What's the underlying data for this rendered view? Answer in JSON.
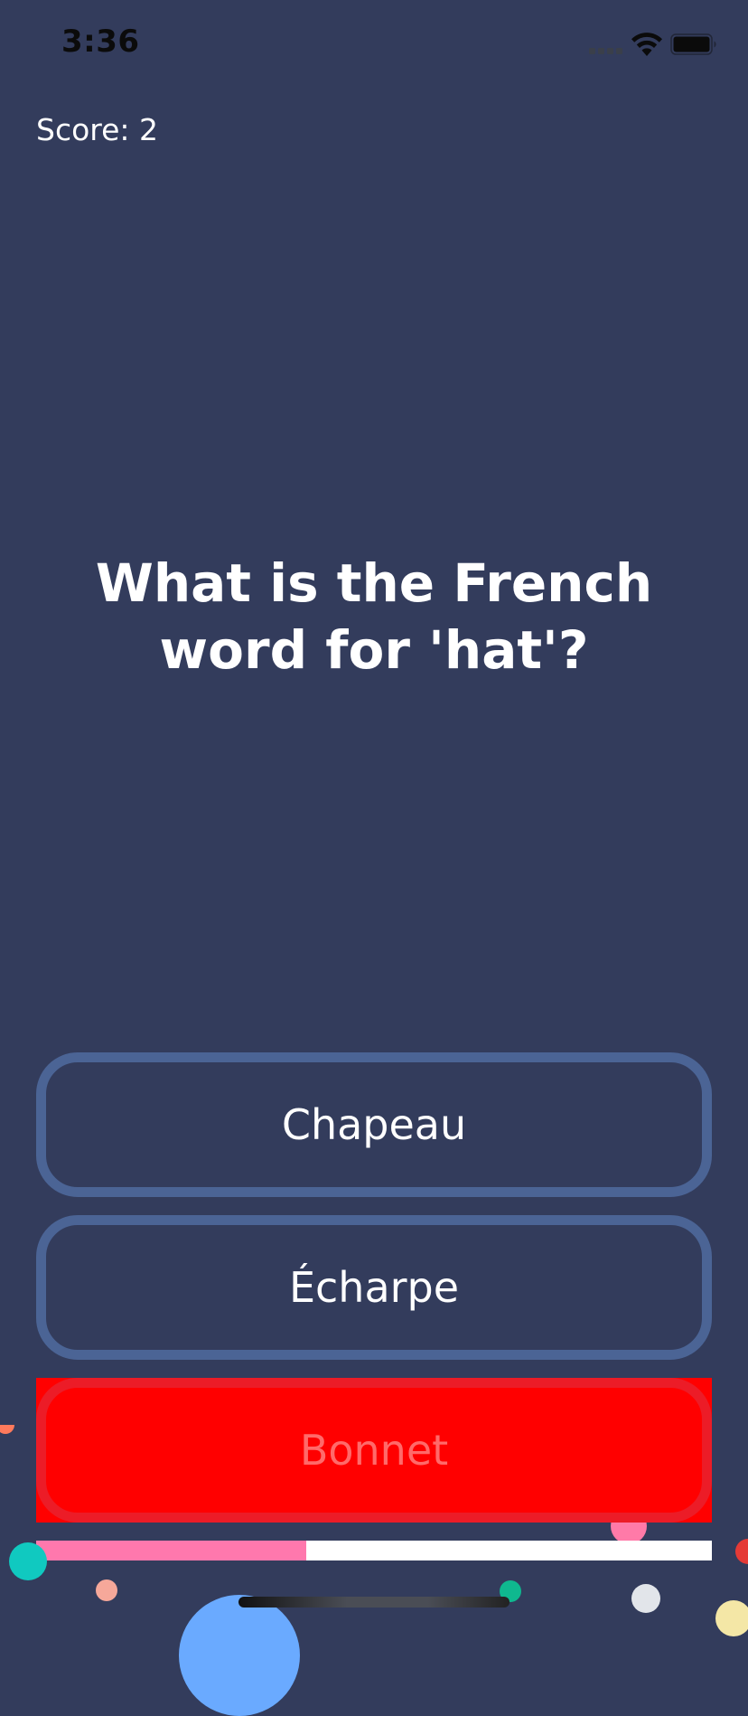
{
  "status_bar": {
    "time": "3:36"
  },
  "score": {
    "label": "Score: 2"
  },
  "question": {
    "text": "What is the French word for 'hat'?"
  },
  "answers": [
    {
      "label": "Chapeau",
      "state": "default"
    },
    {
      "label": "Écharpe",
      "state": "default"
    },
    {
      "label": "Bonnet",
      "state": "wrong"
    }
  ],
  "progress": {
    "fraction": 0.4
  },
  "colors": {
    "background": "#333c5c",
    "answer_border": "#4b6495",
    "wrong_fill": "#ff0000",
    "wrong_border": "#ec1c27",
    "wrong_text": "#ff6a6a",
    "progress_fill": "#ff78ad",
    "progress_track": "#ffffff"
  },
  "icons": {
    "signal": "cellular-signal-icon",
    "wifi": "wifi-icon",
    "battery": "battery-icon"
  }
}
